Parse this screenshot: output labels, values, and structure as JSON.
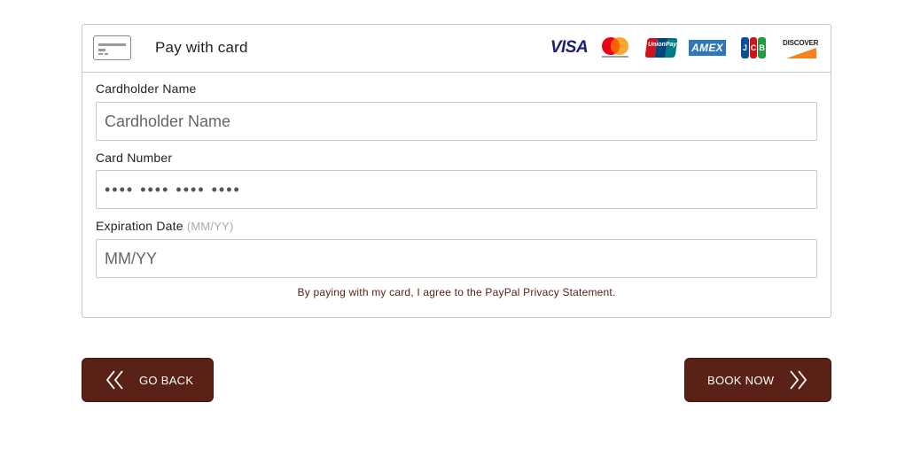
{
  "header": {
    "title": "Pay with card",
    "card_icon": "credit-card-icon",
    "brands": [
      {
        "name": "visa-logo",
        "text": "VISA"
      },
      {
        "name": "mastercard-logo"
      },
      {
        "name": "unionpay-logo",
        "text": "UnionPay"
      },
      {
        "name": "amex-logo",
        "text": "AMEX"
      },
      {
        "name": "jcb-logo",
        "text": "JCB"
      },
      {
        "name": "discover-logo",
        "text": "DISCOVER"
      }
    ]
  },
  "form": {
    "cardholder": {
      "label": "Cardholder Name",
      "placeholder": "Cardholder Name",
      "value": ""
    },
    "card_number": {
      "label": "Card Number",
      "placeholder": "•••• •••• •••• ••••",
      "value": ""
    },
    "expiration": {
      "label": "Expiration Date",
      "hint": "(MM/YY)",
      "placeholder": "MM/YY",
      "value": ""
    },
    "agreement": "By paying with my card, I agree to the PayPal Privacy Statement."
  },
  "buttons": {
    "back": {
      "label": "GO BACK",
      "icon": "double-chevron-left-icon"
    },
    "book": {
      "label": "BOOK NOW",
      "icon": "double-chevron-right-icon"
    }
  },
  "colors": {
    "accent": "#5a2216",
    "border": "#c9c9c9"
  }
}
